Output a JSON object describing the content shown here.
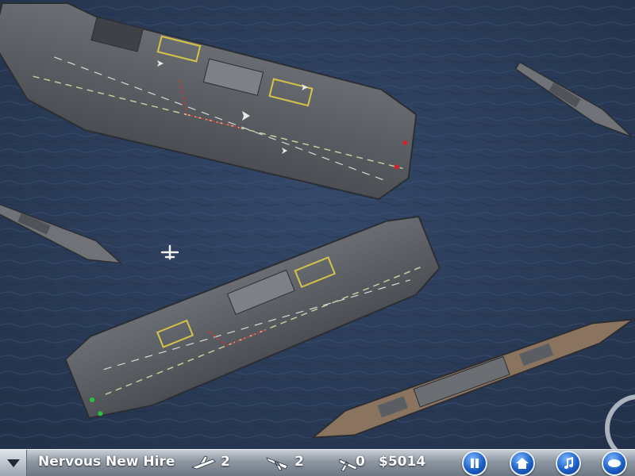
{
  "hud": {
    "rank_title": "Nervous New Hire",
    "launches_value": "2",
    "landings_value": "2",
    "crashes_value": "0",
    "money": "$5014",
    "menu_icon": "triangle-down-icon",
    "launch_icon": "plane-takeoff-icon",
    "landing_icon": "plane-landing-icon",
    "crash_icon": "plane-crash-icon",
    "buttons": [
      {
        "name": "pause-button",
        "icon": "pause-icon"
      },
      {
        "name": "home-button",
        "icon": "home-icon"
      },
      {
        "name": "music-button",
        "icon": "music-note-icon"
      },
      {
        "name": "speed-button",
        "icon": "ellipse-icon"
      }
    ]
  },
  "colors": {
    "sea": "#2c3d56",
    "deck": "#5a5e63",
    "battleship_deck": "#8a7460",
    "hud_text": "#ffffff",
    "button_blue": "#1d5fc4"
  }
}
